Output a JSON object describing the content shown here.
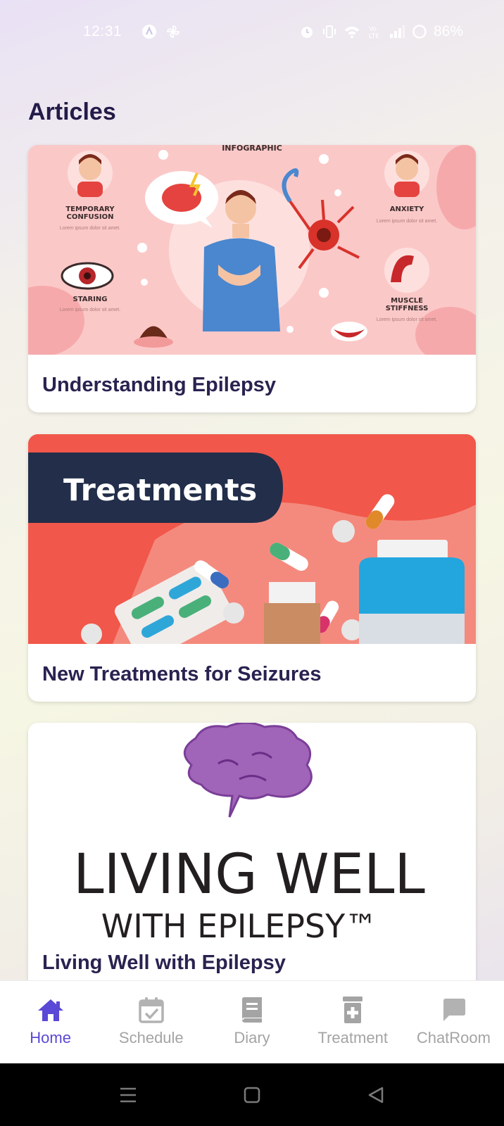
{
  "status_bar": {
    "time": "12:31",
    "battery": "86%",
    "icons": [
      "assistant-icon",
      "pinwheel-icon",
      "alarm-icon",
      "vibrate-icon",
      "wifi-icon",
      "volte-icon",
      "signal-icon",
      "battery-icon"
    ]
  },
  "page": {
    "title": "Articles"
  },
  "articles": [
    {
      "title": "Understanding Epilepsy",
      "image": {
        "header": "INFOGRAPHIC",
        "labels": [
          "TEMPORARY CONFUSION",
          "ANXIETY",
          "STARING",
          "MUSCLE STIFFNESS"
        ],
        "caption": "Lorem ipsum dolor sit amet."
      }
    },
    {
      "title": "New Treatments for Seizures",
      "image": {
        "banner": "Treatments"
      }
    },
    {
      "title": "Living Well with Epilepsy",
      "image": {
        "line1": "LIVING WELL",
        "line2": "WITH EPILEPSY™"
      }
    }
  ],
  "bottom_nav": {
    "items": [
      {
        "label": "Home",
        "icon": "home-icon",
        "active": true
      },
      {
        "label": "Schedule",
        "icon": "calendar-check-icon",
        "active": false
      },
      {
        "label": "Diary",
        "icon": "book-icon",
        "active": false
      },
      {
        "label": "Treatment",
        "icon": "medicine-icon",
        "active": false
      },
      {
        "label": "ChatRoom",
        "icon": "chat-icon",
        "active": false
      }
    ]
  },
  "colors": {
    "accent": "#5a48d6",
    "title": "#231b48",
    "inactive": "#a4a4a4"
  }
}
